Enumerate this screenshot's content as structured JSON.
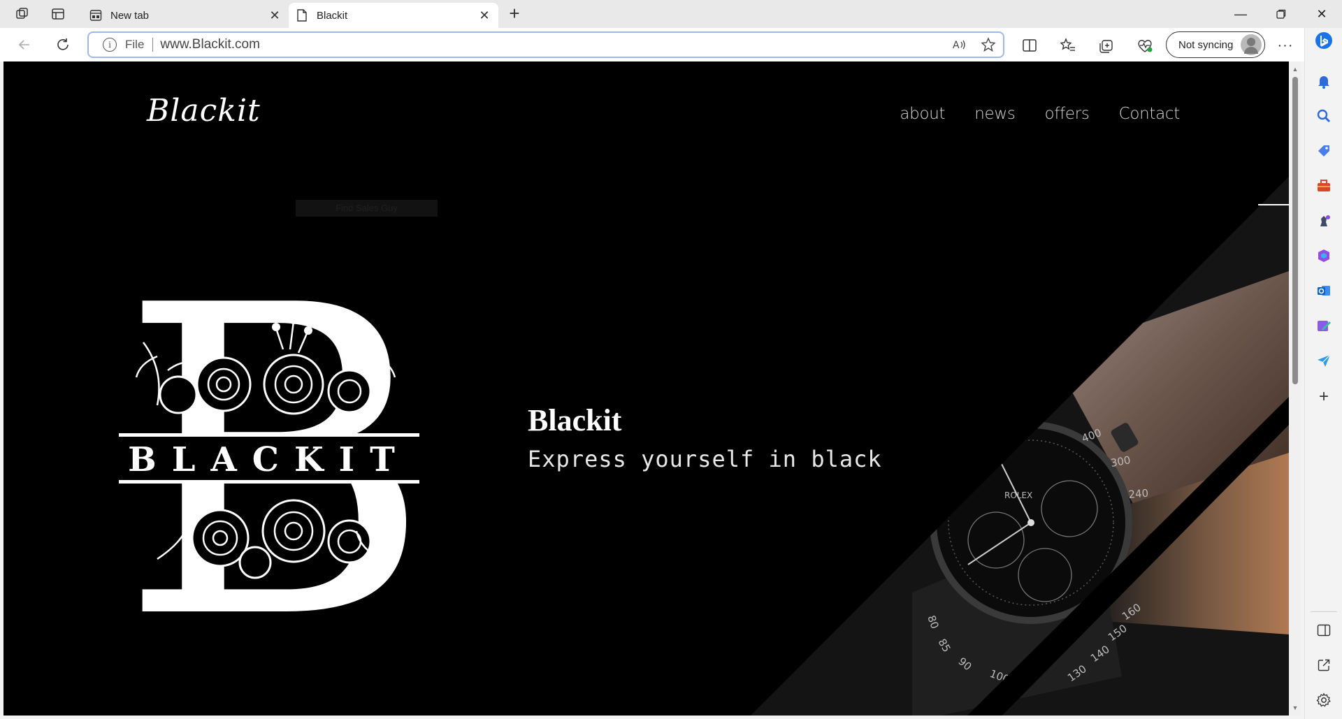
{
  "browser": {
    "tabs": [
      {
        "title": "New tab",
        "active": false
      },
      {
        "title": "Blackit",
        "active": true
      }
    ],
    "address": {
      "scheme_label": "File",
      "url": "www.Blackit.com"
    },
    "profile": {
      "sync_label": "Not syncing"
    },
    "accent_color": "#9fb8e8"
  },
  "page": {
    "brand": "Blackit",
    "nav": [
      "about",
      "news",
      "offers",
      "Contact"
    ],
    "ghost_text": "Find Sales Guy",
    "logo": {
      "letter": "B",
      "wordmark": "BLACKIT"
    },
    "hero": {
      "title": "Blackit",
      "subtitle": "Express yourself in black"
    },
    "watch_dial_numbers": [
      "400",
      "300",
      "240",
      "160",
      "150",
      "140",
      "130",
      "100",
      "90",
      "85",
      "80",
      "ROLEX"
    ],
    "background_color": "#000000"
  },
  "sidebar": {
    "icons": [
      "bing-copilot-icon",
      "bell-icon",
      "search-icon",
      "tag-icon",
      "toolbox-icon",
      "chess-icon",
      "office-icon",
      "outlook-icon",
      "designer-icon",
      "send-icon",
      "add-icon",
      "split-panel-icon",
      "external-link-icon",
      "settings-icon"
    ]
  }
}
